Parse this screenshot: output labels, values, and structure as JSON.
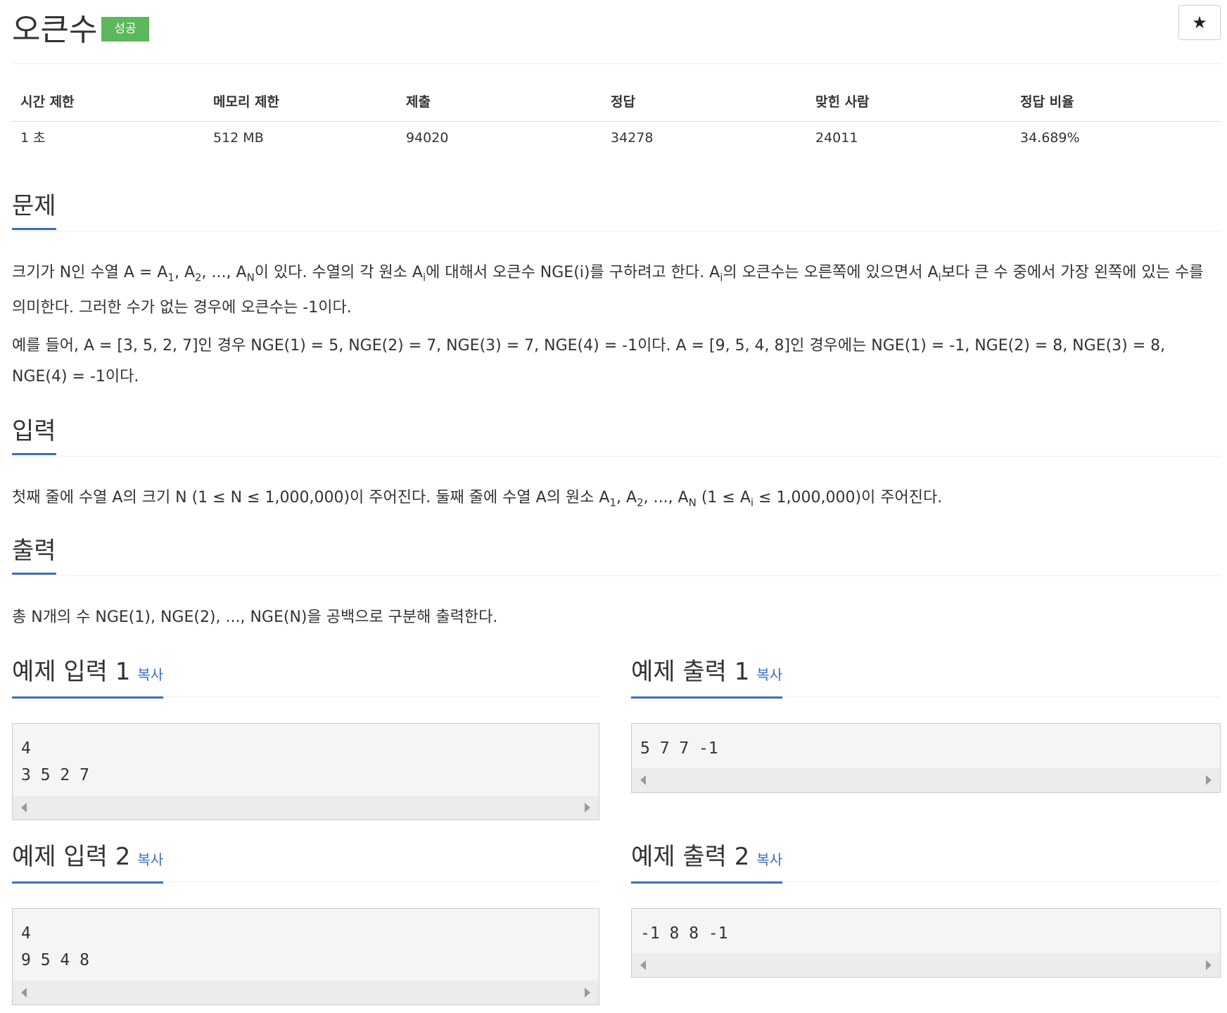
{
  "problem": {
    "title": "오큰수",
    "status_badge": "성공",
    "star_label": "★"
  },
  "info_table": {
    "headers": [
      "시간 제한",
      "메모리 제한",
      "제출",
      "정답",
      "맞힌 사람",
      "정답 비율"
    ],
    "values": [
      "1 초",
      "512 MB",
      "94020",
      "34278",
      "24011",
      "34.689%"
    ]
  },
  "sections": {
    "problem_title": "문제",
    "input_title": "입력",
    "output_title": "출력"
  },
  "problem_text": {
    "p1_a": "크기가 N인 수열 A = A",
    "p1_sub1": "1",
    "p1_b": ", A",
    "p1_sub2": "2",
    "p1_c": ", ..., A",
    "p1_subN": "N",
    "p1_d": "이 있다. 수열의 각 원소 A",
    "p1_subi1": "i",
    "p1_e": "에 대해서 오큰수 NGE(i)를 구하려고 한다. A",
    "p1_subi2": "i",
    "p1_f": "의 오큰수는 오른쪽에 있으면서 A",
    "p1_subi3": "i",
    "p1_g": "보다 큰 수 중에서 가장 왼쪽에 있는 수를 의미한다. 그러한 수가 없는 경우에 오큰수는 -1이다.",
    "p2": "예를 들어, A = [3, 5, 2, 7]인 경우 NGE(1) = 5, NGE(2) = 7, NGE(3) = 7, NGE(4) = -1이다. A = [9, 5, 4, 8]인 경우에는 NGE(1) = -1, NGE(2) = 8, NGE(3) = 8, NGE(4) = -1이다."
  },
  "input_text": {
    "a": "첫째 줄에 수열 A의 크기 N (1 ≤ N ≤ 1,000,000)이 주어진다. 둘째 줄에 수열 A의 원소 A",
    "sub1": "1",
    "b": ", A",
    "sub2": "2",
    "c": ", ..., A",
    "subN": "N",
    "d": " (1 ≤ A",
    "subi": "i",
    "e": " ≤ 1,000,000)이 주어진다."
  },
  "output_text": "총 N개의 수 NGE(1), NGE(2), ..., NGE(N)을 공백으로 구분해 출력한다.",
  "samples": {
    "copy_label": "복사",
    "in1_title": "예제 입력 1",
    "in1_code": "4\n3 5 2 7",
    "out1_title": "예제 출력 1",
    "out1_code": "5 7 7 -1",
    "in2_title": "예제 입력 2",
    "in2_code": "4\n9 5 4 8",
    "out2_title": "예제 출력 2",
    "out2_code": "-1 8 8 -1"
  }
}
